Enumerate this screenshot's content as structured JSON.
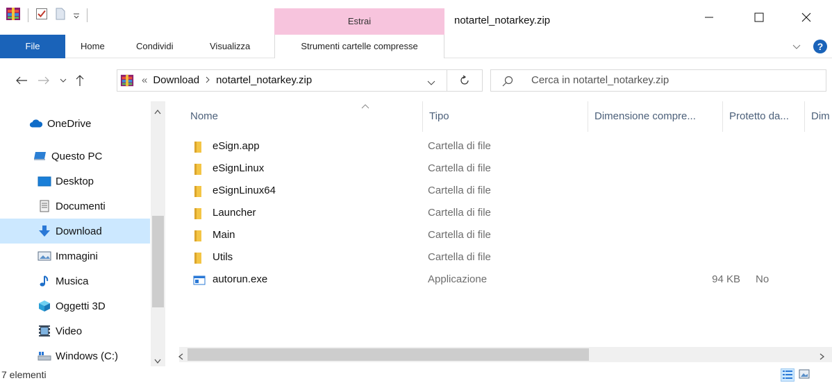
{
  "window": {
    "title": "notartel_notarkey.zip",
    "context_group_label": "Estrai"
  },
  "ribbon": {
    "tabs": [
      "File",
      "Home",
      "Condividi",
      "Visualizza",
      "Strumenti cartelle compresse"
    ]
  },
  "address": {
    "overflow": "«",
    "breadcrumbs": [
      "Download",
      "notartel_notarkey.zip"
    ],
    "search_placeholder": "Cerca in notartel_notarkey.zip"
  },
  "sidebar": {
    "items": [
      {
        "label": "OneDrive",
        "icon": "cloud-icon"
      },
      {
        "label": "Questo PC",
        "icon": "computer-icon"
      },
      {
        "label": "Desktop",
        "icon": "desktop-icon"
      },
      {
        "label": "Documenti",
        "icon": "documents-icon"
      },
      {
        "label": "Download",
        "icon": "download-icon",
        "selected": true
      },
      {
        "label": "Immagini",
        "icon": "pictures-icon"
      },
      {
        "label": "Musica",
        "icon": "music-icon"
      },
      {
        "label": "Oggetti 3D",
        "icon": "cube-icon"
      },
      {
        "label": "Video",
        "icon": "video-icon"
      },
      {
        "label": "Windows  (C:)",
        "icon": "drive-icon"
      }
    ]
  },
  "columns": [
    "Nome",
    "Tipo",
    "Dimensione compre...",
    "Protetto da...",
    "Dim"
  ],
  "files": [
    {
      "name": "eSign.app",
      "type": "Cartella di file",
      "size": "",
      "protected": "",
      "icon": "folder-icon"
    },
    {
      "name": "eSignLinux",
      "type": "Cartella di file",
      "size": "",
      "protected": "",
      "icon": "folder-icon"
    },
    {
      "name": "eSignLinux64",
      "type": "Cartella di file",
      "size": "",
      "protected": "",
      "icon": "folder-icon"
    },
    {
      "name": "Launcher",
      "type": "Cartella di file",
      "size": "",
      "protected": "",
      "icon": "folder-icon"
    },
    {
      "name": "Main",
      "type": "Cartella di file",
      "size": "",
      "protected": "",
      "icon": "folder-icon"
    },
    {
      "name": "Utils",
      "type": "Cartella di file",
      "size": "",
      "protected": "",
      "icon": "folder-icon"
    },
    {
      "name": "autorun.exe",
      "type": "Applicazione",
      "size": "94 KB",
      "protected": "No",
      "icon": "application-icon"
    }
  ],
  "status": {
    "count_text": "7 elementi"
  },
  "colors": {
    "file_tab": "#1a63b9",
    "context_tab": "#f7c4dd",
    "selection": "#cce8ff",
    "folder": "#f4c545"
  }
}
